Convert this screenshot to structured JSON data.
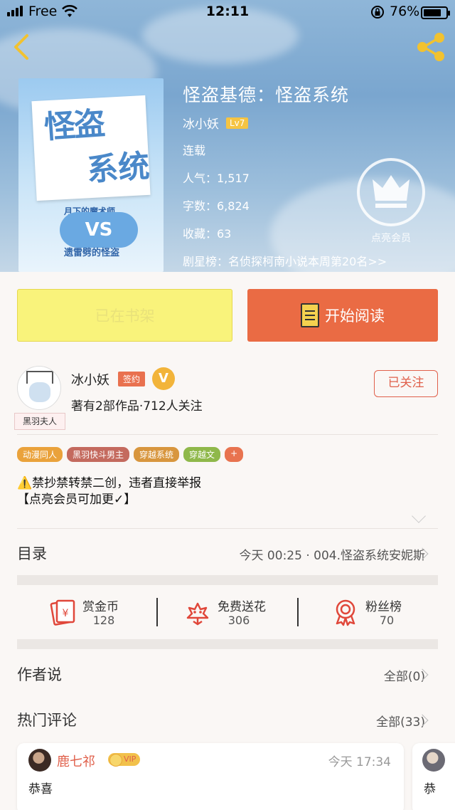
{
  "status_bar": {
    "carrier": "Free",
    "time": "12:11",
    "battery": "76%"
  },
  "book": {
    "title": "怪盗基德：怪盗系统",
    "author": "冰小妖",
    "level": "Lv7",
    "status": "连载",
    "popularity": "人气：1,517",
    "word_count": "字数：6,824",
    "favorites": "收藏：63",
    "ranking": "剧星榜：名侦探柯南小说本周第20名>>",
    "vip_label": "点亮会员"
  },
  "cover": {
    "title_line1": "怪盗",
    "title_line2": "系统",
    "subtitle_top": "月下的魔术师",
    "vs": "VS",
    "subtitle_bottom": "遗雷劈的怪盗"
  },
  "actions": {
    "shelf_label": "已在书架",
    "read_label": "开始阅读"
  },
  "author_card": {
    "name": "冰小妖",
    "sign_badge": "签约",
    "v_badge": "V",
    "stats": "著有2部作品·712人关注",
    "avatar_tag": "黑羽夫人",
    "follow_label": "已关注"
  },
  "tags": [
    {
      "label": "动漫同人",
      "color": "#eaa23b"
    },
    {
      "label": "黑羽快斗男主",
      "color": "#c46a5e"
    },
    {
      "label": "穿越系统",
      "color": "#d8963e"
    },
    {
      "label": "穿越文",
      "color": "#8fb84a"
    },
    {
      "label": "+",
      "color": "#e8734f"
    }
  ],
  "notice": {
    "line1": "⚠️禁抄禁转禁二创，违者直接举报",
    "line2": "【点亮会员可加更✓】"
  },
  "toc": {
    "label": "目录",
    "latest": "今天 00:25 · 004.怪盗系统安妮斯"
  },
  "stats": [
    {
      "label": "赏金币",
      "value": "128",
      "icon": "reward-coin-icon"
    },
    {
      "label": "免费送花",
      "value": "306",
      "icon": "flower-icon"
    },
    {
      "label": "粉丝榜",
      "value": "70",
      "icon": "medal-icon"
    }
  ],
  "author_says": {
    "label": "作者说",
    "count": "全部(0)"
  },
  "hot_comments": {
    "label": "热门评论",
    "count": "全部(33)",
    "items": [
      {
        "user": "鹿七祁",
        "badge": "VIP",
        "time": "今天 17:34",
        "text": "恭喜"
      },
      {
        "text": "恭"
      }
    ]
  }
}
